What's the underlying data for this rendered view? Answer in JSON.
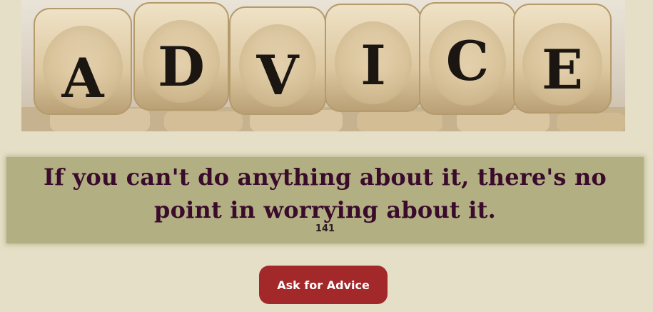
{
  "banner": {
    "letters": [
      "A",
      "D",
      "V",
      "I",
      "C",
      "E"
    ],
    "alt": "ADVICE"
  },
  "quote": {
    "text": "If you can't do anything about it, there's no point in worrying about it.",
    "id": "141"
  },
  "button": {
    "label": "Ask for Advice"
  },
  "colors": {
    "background": "#e4dfc6",
    "quote_box": "#b2b083",
    "quote_text": "#3b0b2c",
    "button": "#a2282a"
  }
}
